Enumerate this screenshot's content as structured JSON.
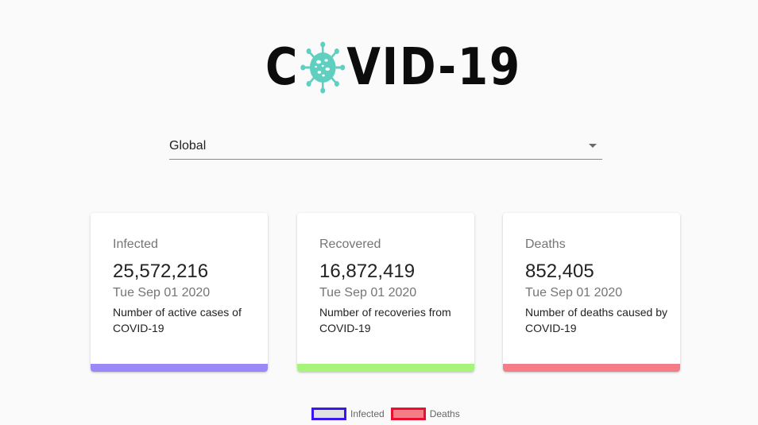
{
  "logo": {
    "text_before": "C",
    "text_after": "VID-19",
    "icon": "virus-icon",
    "icon_color": "#5fcfc0"
  },
  "country_select": {
    "value": "Global",
    "icon": "dropdown-arrow-icon"
  },
  "cards": {
    "infected": {
      "label": "Infected",
      "value": "25,572,216",
      "date": "Tue Sep 01 2020",
      "description": "Number of active cases of COVID-19",
      "accent": "#9b87f5"
    },
    "recovered": {
      "label": "Recovered",
      "value": "16,872,419",
      "date": "Tue Sep 01 2020",
      "description": "Number of recoveries from COVID-19",
      "accent": "#a6f57a"
    },
    "deaths": {
      "label": "Deaths",
      "value": "852,405",
      "date": "Tue Sep 01 2020",
      "description": "Number of deaths caused by COVID-19",
      "accent": "#f47d87"
    }
  },
  "legend": [
    {
      "label": "Infected",
      "border": "#3a16f0",
      "fill": "#e1e1e1"
    },
    {
      "label": "Deaths",
      "border": "#e8112f",
      "fill": "#f47d87"
    }
  ]
}
